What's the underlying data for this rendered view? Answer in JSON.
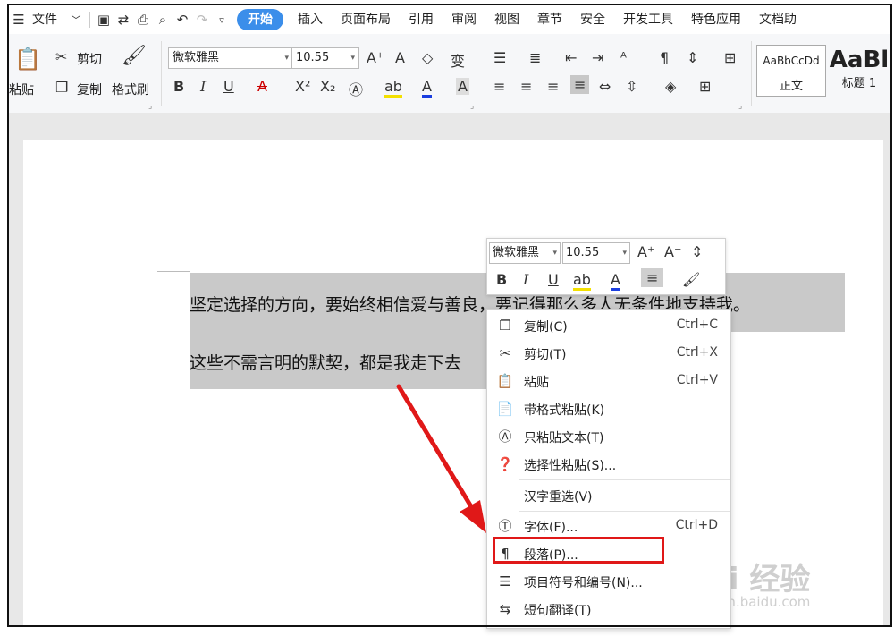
{
  "menubar": {
    "file": "文件",
    "active_tab": "开始",
    "tabs": [
      "插入",
      "页面布局",
      "引用",
      "审阅",
      "视图",
      "章节",
      "安全",
      "开发工具",
      "特色应用",
      "文档助"
    ]
  },
  "ribbon": {
    "paste": "粘贴",
    "cut": "剪切",
    "copy": "复制",
    "format_painter": "格式刷",
    "font_name": "微软雅黑",
    "font_size": "10.55",
    "style_normal_preview": "AaBbCcDd",
    "style_normal": "正文",
    "style_h1_preview": "AaBl",
    "style_h1": "标题 1"
  },
  "document": {
    "line1": "坚定选择的方向，要始终相信爱与善良，要记得那么多人无条件地支持我。",
    "line2": "这些不需言明的默契，都是我走下去"
  },
  "mini_toolbar": {
    "font_name": "微软雅黑",
    "font_size": "10.55"
  },
  "context_menu": {
    "copy": "复制(C)",
    "copy_sc": "Ctrl+C",
    "cut": "剪切(T)",
    "cut_sc": "Ctrl+X",
    "paste": "粘贴",
    "paste_sc": "Ctrl+V",
    "paste_format": "带格式粘贴(K)",
    "paste_text": "只粘贴文本(T)",
    "paste_special": "选择性粘贴(S)...",
    "reselect": "汉字重选(V)",
    "font": "字体(F)...",
    "font_sc": "Ctrl+D",
    "paragraph": "段落(P)...",
    "bullets": "项目符号和编号(N)...",
    "translate": "短句翻译(T)"
  },
  "watermark": {
    "brand": "Bai 经验",
    "url": "jingyan.baidu.com"
  },
  "colors": {
    "accent": "#3b8eea",
    "highlight_red": "#e01818",
    "selection_gray": "#c9c9c9"
  }
}
